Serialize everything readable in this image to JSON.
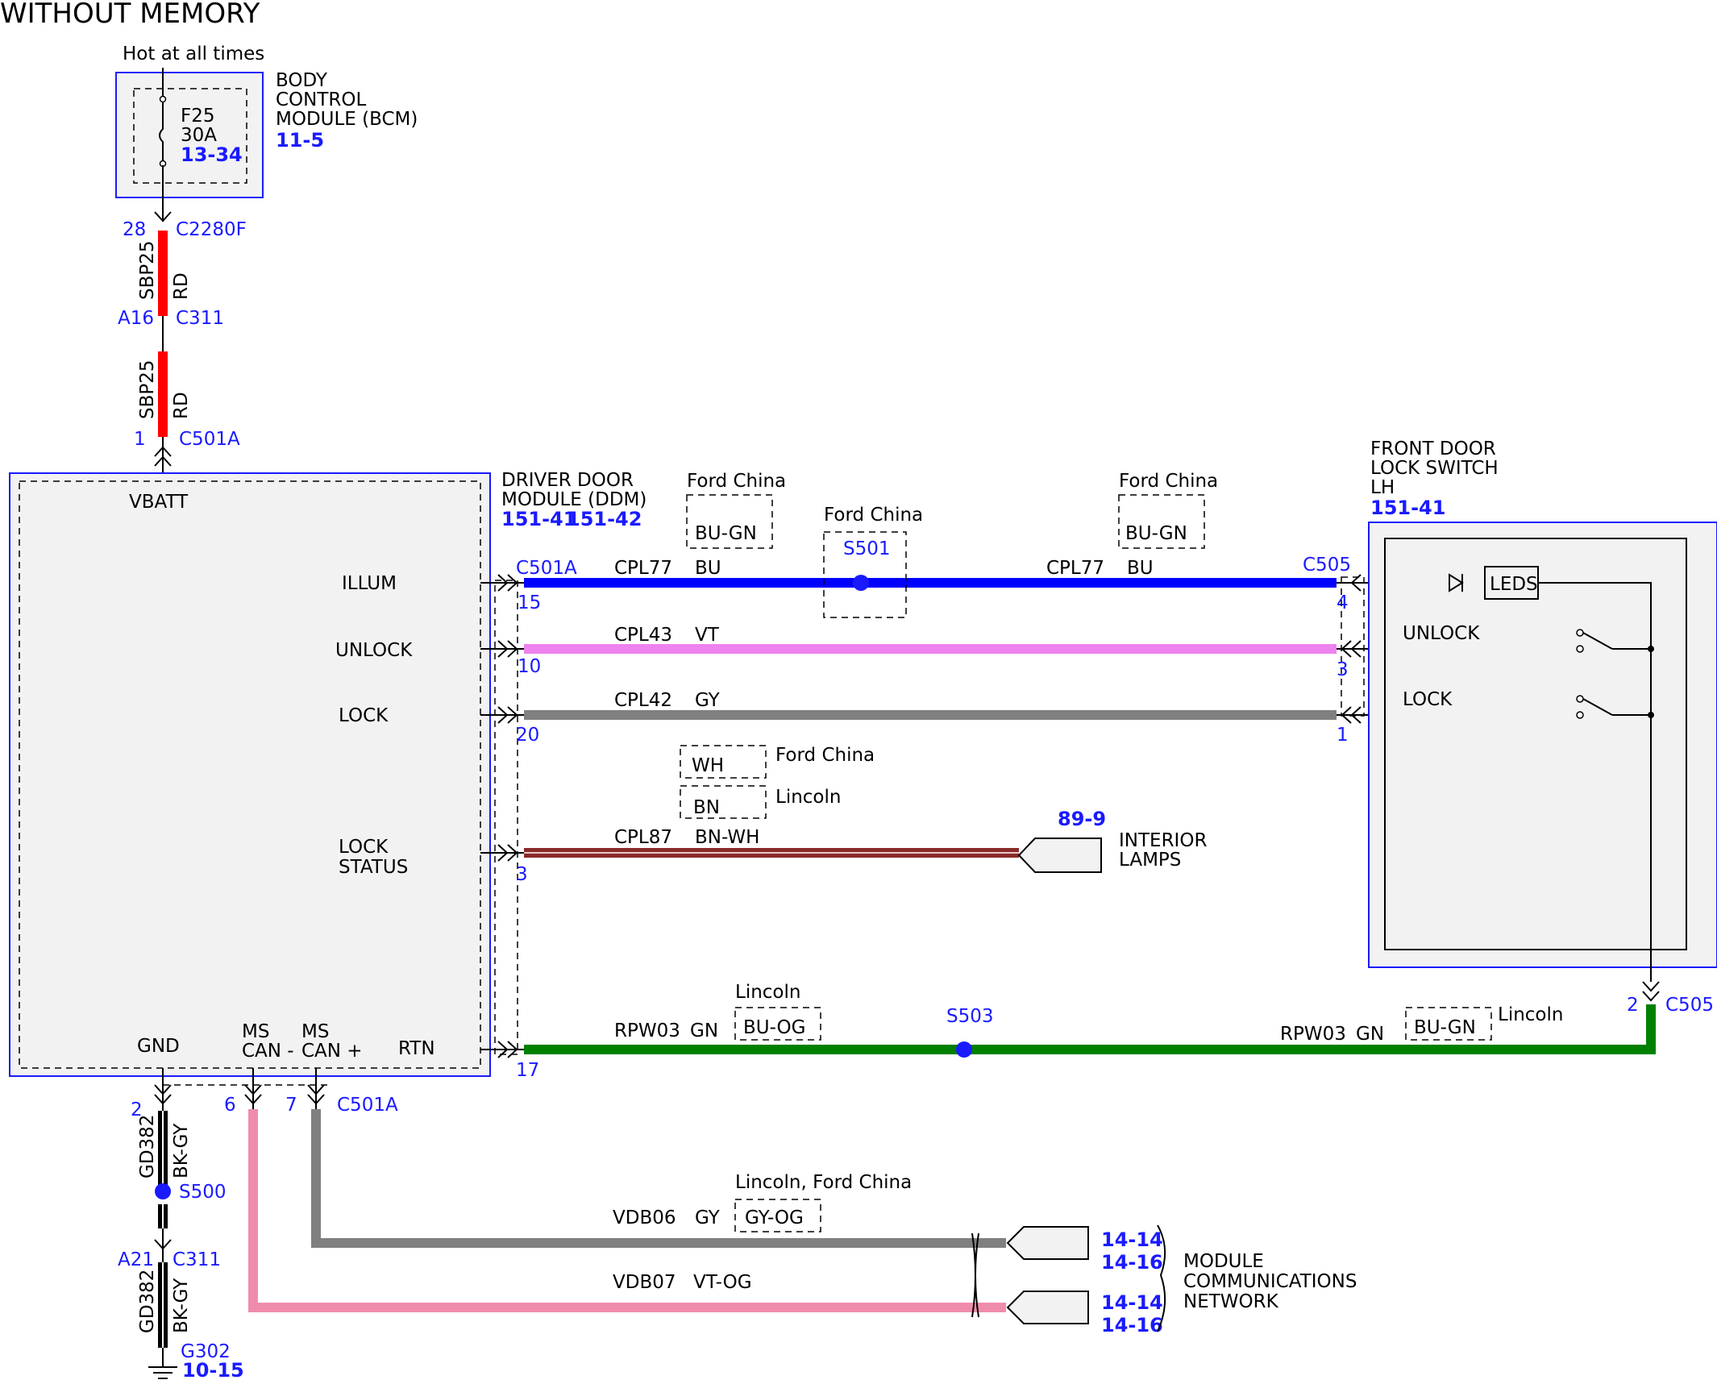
{
  "title": "WITHOUT MEMORY",
  "supply": {
    "hot_label": "Hot at all times"
  },
  "bcm": {
    "name_lines": [
      "BODY",
      "CONTROL",
      "MODULE (BCM)"
    ],
    "ref": "11-5",
    "fuse": {
      "name": "F25",
      "rating": "30A",
      "ref": "13-34"
    }
  },
  "vbatt_feed": {
    "bcm_pin": "28",
    "bcm_connector": "C2280F",
    "circuit": "SBP25",
    "color": "RD",
    "inline_pin": "A16",
    "inline_connector": "C311",
    "ddm_pin": "1",
    "ddm_connector": "C501A",
    "wire_color_hex": "#ff0000"
  },
  "ddm": {
    "name_lines": [
      "DRIVER DOOR",
      "MODULE (DDM)"
    ],
    "refs": [
      "151-41",
      "151-42"
    ],
    "pins": {
      "vbatt": "VBATT",
      "illum": "ILLUM",
      "unlock": "UNLOCK",
      "lock": "LOCK",
      "lock_status": [
        "LOCK",
        "STATUS"
      ],
      "gnd": "GND",
      "ms_can_minus": [
        "MS",
        "CAN -"
      ],
      "ms_can_plus": [
        "MS",
        "CAN +"
      ],
      "rtn": "RTN"
    }
  },
  "circuits": {
    "illum": {
      "connector_left": "C501A",
      "pin_left": "15",
      "circuit": "CPL77",
      "color": "BU",
      "splice": "S501",
      "splice_variant": "Ford China",
      "alt_left": {
        "variant": "Ford China",
        "color": "BU-GN"
      },
      "circuit_right": "CPL77",
      "color_right": "BU",
      "alt_right": {
        "variant": "Ford China",
        "color": "BU-GN"
      },
      "connector_right": "C505",
      "pin_right": "4",
      "wire_color_hex": "#0000ff"
    },
    "unlock": {
      "pin_left": "10",
      "circuit": "CPL43",
      "color": "VT",
      "pin_right": "3",
      "wire_color_hex": "#ee82ee"
    },
    "lock": {
      "pin_left": "20",
      "circuit": "CPL42",
      "color": "GY",
      "pin_right": "1",
      "wire_color_hex": "#808080"
    },
    "lock_status": {
      "pin_left": "3",
      "circuit": "CPL87",
      "color": "BN-WH",
      "alts": [
        {
          "color": "WH",
          "variant": "Ford China"
        },
        {
          "color": "BN",
          "variant": "Lincoln"
        }
      ],
      "dest_ref": "89-9",
      "dest_lines": [
        "INTERIOR",
        "LAMPS"
      ],
      "wire_color_hex": "#8b2a2a"
    },
    "rtn": {
      "pin_left": "17",
      "circuit": "RPW03",
      "color": "GN",
      "alt_left": {
        "variant": "Lincoln",
        "color": "BU-OG"
      },
      "splice": "S503",
      "circuit_right": "RPW03",
      "color_right": "GN",
      "alt_right": {
        "variant": "Lincoln",
        "color": "BU-GN"
      },
      "pin_right": "2",
      "connector_right": "C505",
      "wire_color_hex": "#008000"
    },
    "gnd": {
      "ddm_pin": "2",
      "circuit": "GD382",
      "color": "BK-GY",
      "splice": "S500",
      "inline_pin": "A21",
      "inline_connector": "C311",
      "circuit_lower": "GD382",
      "color_lower": "BK-GY",
      "ground": "G302",
      "ground_ref": "10-15",
      "wire_color_hex": "#000000"
    },
    "can_minus": {
      "pin": "6",
      "circuit": "VDB07",
      "color": "VT-OG",
      "refs": [
        "14-14",
        "14-16"
      ],
      "wire_color_hex": "#f08cab"
    },
    "can_plus": {
      "pin": "7",
      "connector": "C501A",
      "circuit": "VDB06",
      "color": "GY",
      "alt": {
        "variant": "Lincoln, Ford China",
        "color": "GY-OG"
      },
      "refs": [
        "14-14",
        "14-16"
      ],
      "wire_color_hex": "#808080"
    }
  },
  "network_lines": [
    "MODULE",
    "COMMUNICATIONS",
    "NETWORK"
  ],
  "switch": {
    "name_lines": [
      "FRONT DOOR",
      "LOCK SWITCH",
      "LH"
    ],
    "ref": "151-41",
    "leds": "LEDS",
    "unlock": "UNLOCK",
    "lock": "LOCK"
  }
}
